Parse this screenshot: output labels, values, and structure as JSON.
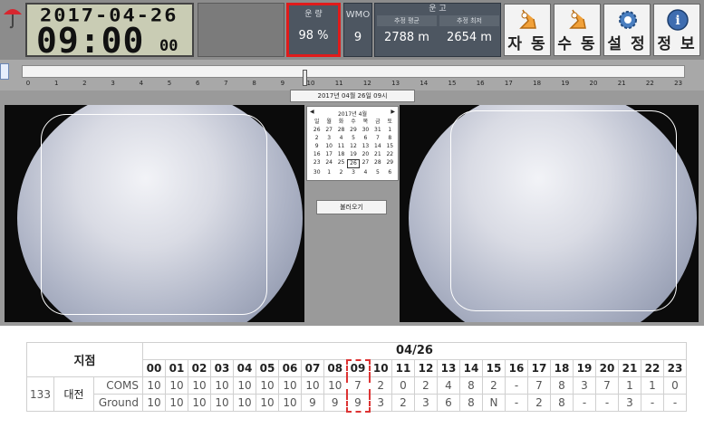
{
  "header": {
    "date": "2017-04-26",
    "time": "09:00",
    "seconds": "00",
    "operation": {
      "label": "운 량",
      "value": "98 %"
    },
    "wmo": {
      "label": "WMO",
      "value": "9"
    },
    "cloud_height": {
      "label": "운 고",
      "avg_label": "추정 평균",
      "min_label": "추정 최저",
      "avg_value": "2788 m",
      "min_value": "2654 m"
    },
    "buttons": {
      "auto": "자 동",
      "manual": "수 동",
      "settings": "설 정",
      "info": "정 보"
    }
  },
  "timeline": {
    "hours": [
      "0",
      "1",
      "2",
      "3",
      "4",
      "5",
      "6",
      "7",
      "8",
      "9",
      "10",
      "11",
      "12",
      "13",
      "14",
      "15",
      "16",
      "17",
      "18",
      "19",
      "20",
      "21",
      "22",
      "23"
    ],
    "selected_hour": 9,
    "date_button": "2017년 04월 26일 09시"
  },
  "calendar": {
    "title": "2017년 4월",
    "prev": "◀",
    "next": "▶",
    "weekdays": [
      "일",
      "월",
      "화",
      "수",
      "목",
      "금",
      "토"
    ],
    "days": [
      "26",
      "27",
      "28",
      "29",
      "30",
      "31",
      "1",
      "2",
      "3",
      "4",
      "5",
      "6",
      "7",
      "8",
      "9",
      "10",
      "11",
      "12",
      "13",
      "14",
      "15",
      "16",
      "17",
      "18",
      "19",
      "20",
      "21",
      "22",
      "23",
      "24",
      "25",
      "26",
      "27",
      "28",
      "29",
      "30",
      "1",
      "2",
      "3",
      "4",
      "5",
      "6"
    ],
    "selected_index": 31
  },
  "load_button": "불러오기",
  "table": {
    "station_header": "지점",
    "date_header": "04/26",
    "hours": [
      "00",
      "01",
      "02",
      "03",
      "04",
      "05",
      "06",
      "07",
      "08",
      "09",
      "10",
      "11",
      "12",
      "13",
      "14",
      "15",
      "16",
      "17",
      "18",
      "19",
      "20",
      "21",
      "22",
      "23"
    ],
    "station_id": "133",
    "station_name": "대전",
    "rows": [
      {
        "label": "COMS",
        "values": [
          "10",
          "10",
          "10",
          "10",
          "10",
          "10",
          "10",
          "10",
          "10",
          "7",
          "2",
          "0",
          "2",
          "4",
          "8",
          "2",
          "-",
          "7",
          "8",
          "3",
          "7",
          "1",
          "1",
          "0"
        ]
      },
      {
        "label": "Ground",
        "values": [
          "10",
          "10",
          "10",
          "10",
          "10",
          "10",
          "10",
          "9",
          "9",
          "9",
          "3",
          "2",
          "3",
          "6",
          "8",
          "N",
          "-",
          "2",
          "8",
          "-",
          "-",
          "3",
          "-",
          "-"
        ]
      }
    ]
  },
  "colors": {
    "highlight": "#e01b1b",
    "panel": "#4d5661"
  }
}
